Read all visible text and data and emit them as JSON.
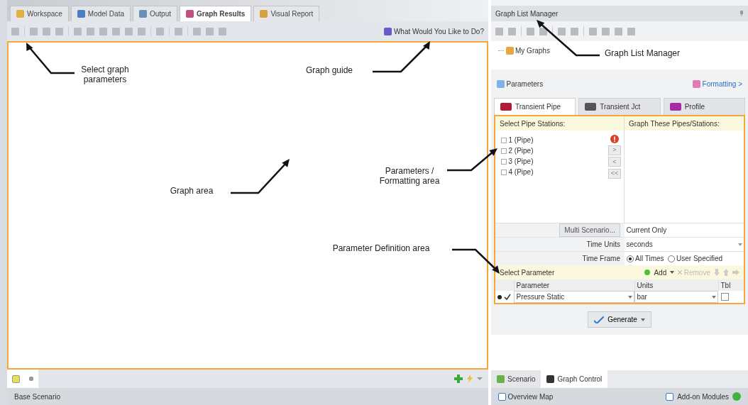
{
  "main_tabs": [
    {
      "label": "Workspace",
      "selected": false
    },
    {
      "label": "Model Data",
      "selected": false
    },
    {
      "label": "Output",
      "selected": false
    },
    {
      "label": "Graph Results",
      "selected": true
    },
    {
      "label": "Visual Report",
      "selected": false
    }
  ],
  "guide_link": "What Would You Like to Do?",
  "graph_list_manager": {
    "title": "Graph List Manager",
    "tree": [
      {
        "label": "My Graphs"
      }
    ]
  },
  "parameters_bar": {
    "title": "Parameters",
    "formatting_link": "Formatting >"
  },
  "param_tabs": [
    {
      "label": "Transient Pipe",
      "selected": true,
      "color": "#b01c33"
    },
    {
      "label": "Transient Jct",
      "selected": false,
      "color": "#555555"
    },
    {
      "label": "Profile",
      "selected": false,
      "color": "#a62ca6"
    }
  ],
  "stations": {
    "left_header": "Select Pipe Stations:",
    "right_header": "Graph These Pipes/Stations:",
    "items": [
      {
        "label": "1 (Pipe)"
      },
      {
        "label": "2 (Pipe)"
      },
      {
        "label": "3 (Pipe)"
      },
      {
        "label": "4 (Pipe)"
      }
    ]
  },
  "transfer_buttons": [
    ">",
    "<",
    "<<"
  ],
  "multi_scenario": {
    "button": "Multi Scenario...",
    "value": "Current Only"
  },
  "time_units": {
    "label": "Time Units",
    "value": "seconds"
  },
  "time_frame": {
    "label": "Time Frame",
    "options": [
      {
        "label": "All Times",
        "selected": true
      },
      {
        "label": "User Specified",
        "selected": false
      }
    ]
  },
  "select_parameter": {
    "title": "Select Parameter",
    "add": "Add",
    "remove": "Remove"
  },
  "parameter_table": {
    "columns": [
      "Parameter",
      "Units",
      "Tbl"
    ],
    "rows": [
      {
        "parameter": "Pressure Static",
        "units": "bar",
        "checked": true,
        "tbl": false
      }
    ]
  },
  "generate": "Generate",
  "status_left": "Base Scenario",
  "side_tabs": [
    {
      "label": "Scenario",
      "selected": false
    },
    {
      "label": "Graph Control",
      "selected": true
    }
  ],
  "status_right": {
    "overview": "Overview Map",
    "addons": "Add-on Modules"
  },
  "annotations": [
    {
      "text": "Select graph parameters"
    },
    {
      "text": "Graph guide"
    },
    {
      "text": "Graph List Manager"
    },
    {
      "text": "Parameters / Formatting area"
    },
    {
      "text": "Graph area"
    },
    {
      "text": "Parameter Definition area"
    }
  ]
}
